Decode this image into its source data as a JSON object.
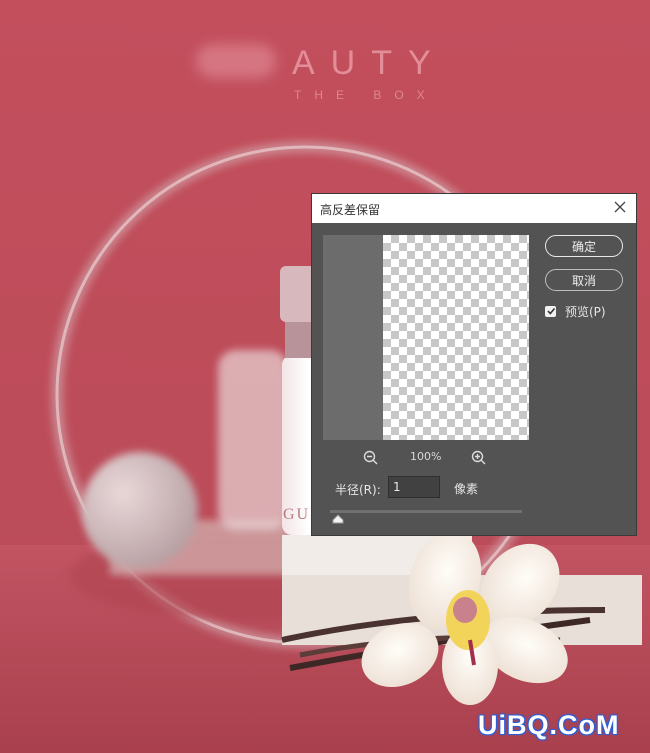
{
  "background": {
    "brand_text": "AUTY",
    "brand_subtitle": "THE BOX",
    "bottle_text": "GUE",
    "watermark": "UiBQ.CoM",
    "colors": {
      "wall": "#c45563",
      "floor": "#b94c58"
    }
  },
  "dialog": {
    "title": "高反差保留",
    "close_icon": "close-icon",
    "ok_label": "确定",
    "cancel_label": "取消",
    "preview_label": "预览(P)",
    "preview_checked": true,
    "zoom_out_icon": "zoom-out-icon",
    "zoom_in_icon": "zoom-in-icon",
    "zoom_level": "100%",
    "radius_label": "半径(R):",
    "radius_value": "1",
    "radius_unit": "像素"
  }
}
